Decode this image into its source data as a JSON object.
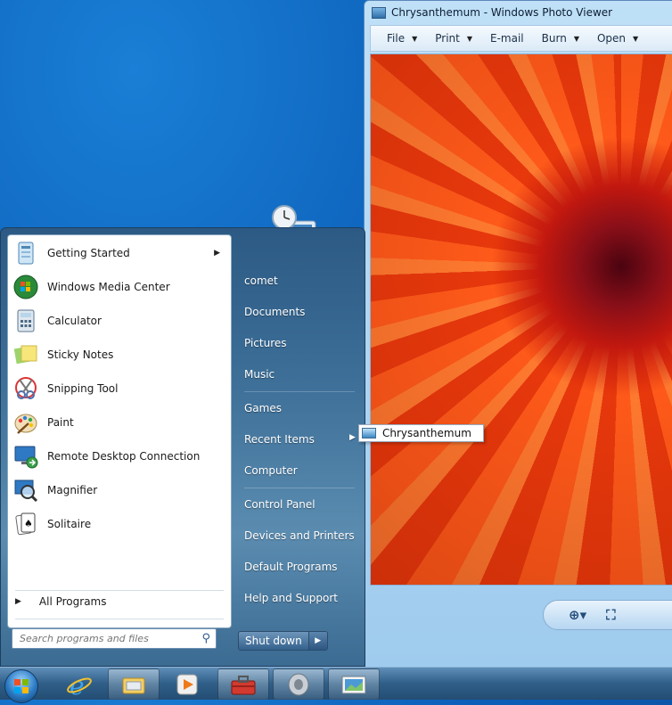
{
  "viewer": {
    "title": "Chrysanthemum - Windows Photo Viewer",
    "menu": [
      {
        "label": "File",
        "has_arrow": true
      },
      {
        "label": "Print",
        "has_arrow": true
      },
      {
        "label": "E-mail",
        "has_arrow": false
      },
      {
        "label": "Burn",
        "has_arrow": true
      },
      {
        "label": "Open",
        "has_arrow": true
      }
    ]
  },
  "start_menu": {
    "programs": [
      {
        "label": "Getting Started",
        "icon": "getting-started-icon",
        "submenu": true
      },
      {
        "label": "Windows Media Center",
        "icon": "media-center-icon",
        "submenu": false
      },
      {
        "label": "Calculator",
        "icon": "calculator-icon",
        "submenu": false
      },
      {
        "label": "Sticky Notes",
        "icon": "sticky-notes-icon",
        "submenu": false
      },
      {
        "label": "Snipping Tool",
        "icon": "snipping-tool-icon",
        "submenu": false
      },
      {
        "label": "Paint",
        "icon": "paint-icon",
        "submenu": false
      },
      {
        "label": "Remote Desktop Connection",
        "icon": "remote-desktop-icon",
        "submenu": false
      },
      {
        "label": "Magnifier",
        "icon": "magnifier-icon",
        "submenu": false
      },
      {
        "label": "Solitaire",
        "icon": "solitaire-icon",
        "submenu": false
      }
    ],
    "all_programs": "All Programs",
    "search_placeholder": "Search programs and files",
    "places": [
      {
        "label": "comet"
      },
      {
        "label": "Documents"
      },
      {
        "label": "Pictures"
      },
      {
        "label": "Music"
      },
      {
        "label": "Games"
      },
      {
        "label": "Recent Items",
        "submenu": true
      },
      {
        "label": "Computer"
      },
      {
        "label": "Control Panel"
      },
      {
        "label": "Devices and Printers"
      },
      {
        "label": "Default Programs"
      },
      {
        "label": "Help and Support"
      }
    ],
    "shutdown": "Shut down"
  },
  "recent_items": [
    {
      "label": "Chrysanthemum"
    }
  ],
  "taskbar": {
    "pinned": [
      "internet-explorer-icon",
      "explorer-icon",
      "media-player-icon",
      "toolbox-icon",
      "speaker-icon",
      "photo-viewer-icon"
    ]
  }
}
